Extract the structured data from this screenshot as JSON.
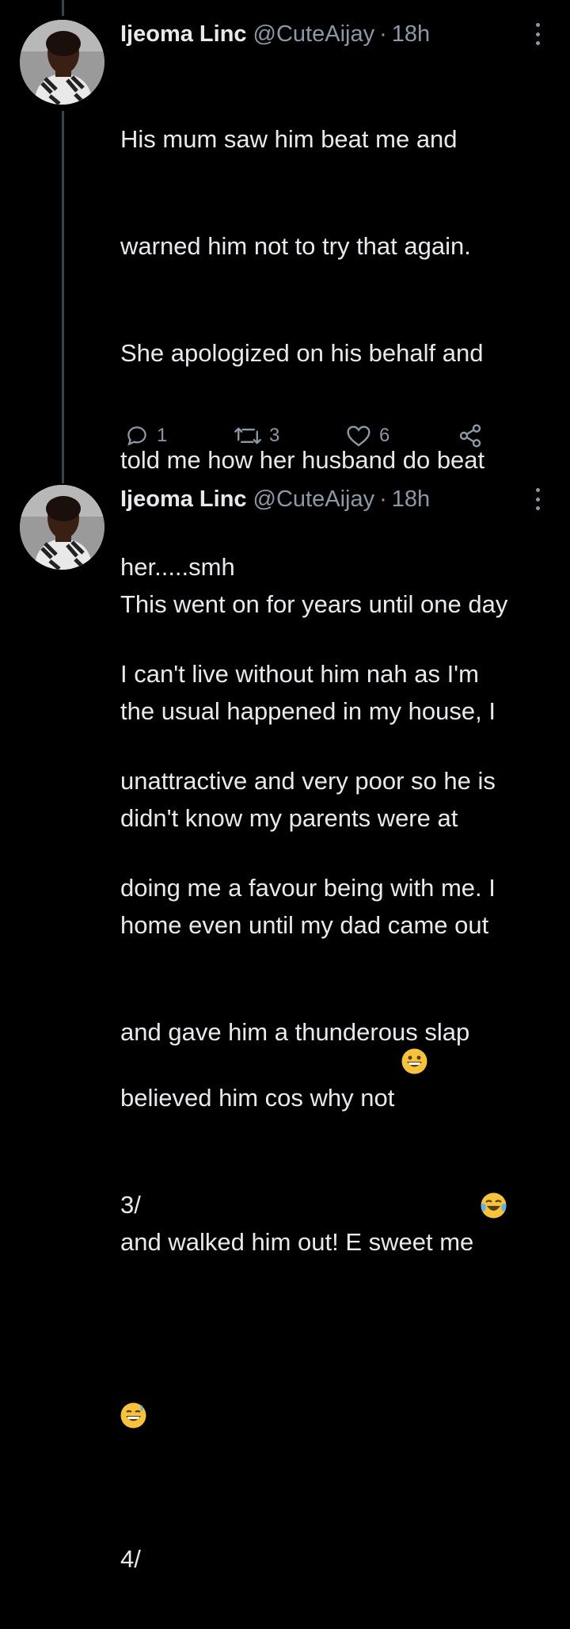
{
  "tweets": [
    {
      "author_name": "Ijeoma Linc",
      "handle": "@CuteAijay",
      "separator": "·",
      "time": "18h",
      "lines": [
        "His mum saw him beat me and",
        "warned him not to try that again.",
        "She apologized on his behalf and",
        "told me how her husband do beat",
        "her.....smh",
        "I can't live without him nah as I'm",
        "unattractive and very poor so he is",
        "doing me a favour being with me. I",
        "believed him cos why not",
        "3/"
      ],
      "emoji": [
        "grinning-face"
      ],
      "replies": "1",
      "retweets": "3",
      "likes": "6"
    },
    {
      "author_name": "Ijeoma Linc",
      "handle": "@CuteAijay",
      "separator": "·",
      "time": "18h",
      "lines": [
        "This went on for years until one day",
        "the usual happened in my house, I",
        "didn't know my parents were at",
        "home even until my dad came out",
        "and gave him a thunderous slap",
        "and walked him out! E sweet me",
        "",
        "4/"
      ],
      "emoji": [
        "face-with-tears-of-joy",
        "grinning-face-with-sweat"
      ]
    }
  ],
  "colors": {
    "background": "#000000",
    "text": "#e7e9ea",
    "secondary": "#8b98a5",
    "thread_line": "#38444d",
    "emoji_yellow": "#f7c33c"
  }
}
